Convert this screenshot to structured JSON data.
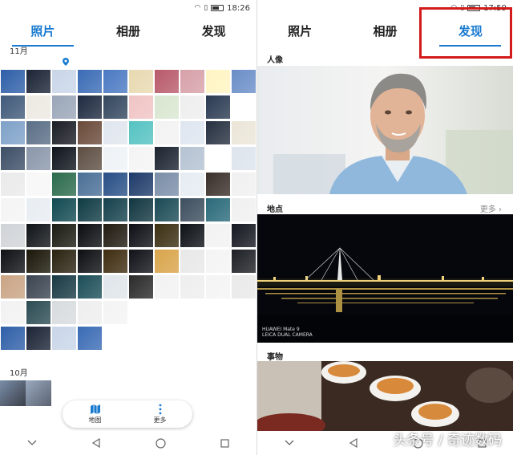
{
  "left": {
    "status": {
      "time": "18:26"
    },
    "tabs": [
      {
        "label": "照片",
        "active": true
      },
      {
        "label": "相册",
        "active": false
      },
      {
        "label": "发现",
        "active": false
      }
    ],
    "month_label": "11月",
    "october_label": "10月",
    "bottom_actions": [
      {
        "label": "地图",
        "icon": "map-icon"
      },
      {
        "label": "更多",
        "icon": "more-vertical-icon"
      }
    ]
  },
  "right": {
    "status": {
      "time": "17:59"
    },
    "tabs": [
      {
        "label": "照片",
        "active": false
      },
      {
        "label": "相册",
        "active": false
      },
      {
        "label": "发现",
        "active": true
      }
    ],
    "sections": {
      "portrait": {
        "title": "人像"
      },
      "places": {
        "title": "地点",
        "more": "更多"
      },
      "things": {
        "title": "事物"
      }
    },
    "camera_watermark": {
      "line1": "HUAWEI Mate 9",
      "line2": "LEICA DUAL CAMERA"
    }
  },
  "site_watermark": "头条号 / 奇迹数码",
  "colors": {
    "accent": "#1a7bd0",
    "highlight": "#d41b1b"
  }
}
